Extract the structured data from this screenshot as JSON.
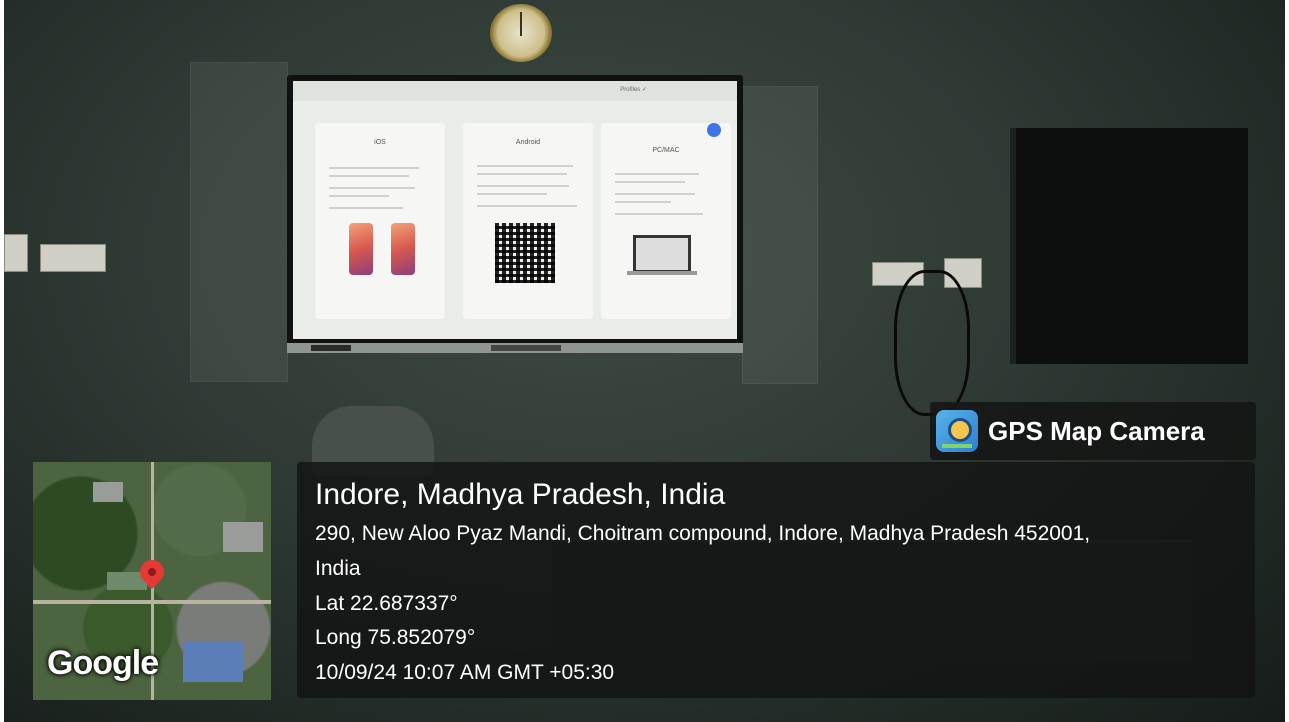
{
  "overlay": {
    "app_name": "GPS Map Camera",
    "app_icon": "gps-map-camera-icon",
    "map_logo": "Google",
    "location_title": "Indore, Madhya Pradesh, India",
    "address_line1": "290, New Aloo Pyaz Mandi, Choitram compound, Indore, Madhya Pradesh 452001,",
    "address_line2": "India",
    "latitude": "Lat 22.687337°",
    "longitude": "Long 75.852079°",
    "datetime": "10/09/24 10:07 AM GMT +05:30"
  },
  "tv_screen": {
    "header_text": "Profiles ✓",
    "cards": [
      "iOS",
      "Android",
      "PC/MAC"
    ]
  },
  "colors": {
    "overlay_bg": "#121413",
    "pin": "#e53935",
    "text": "#ffffff"
  }
}
